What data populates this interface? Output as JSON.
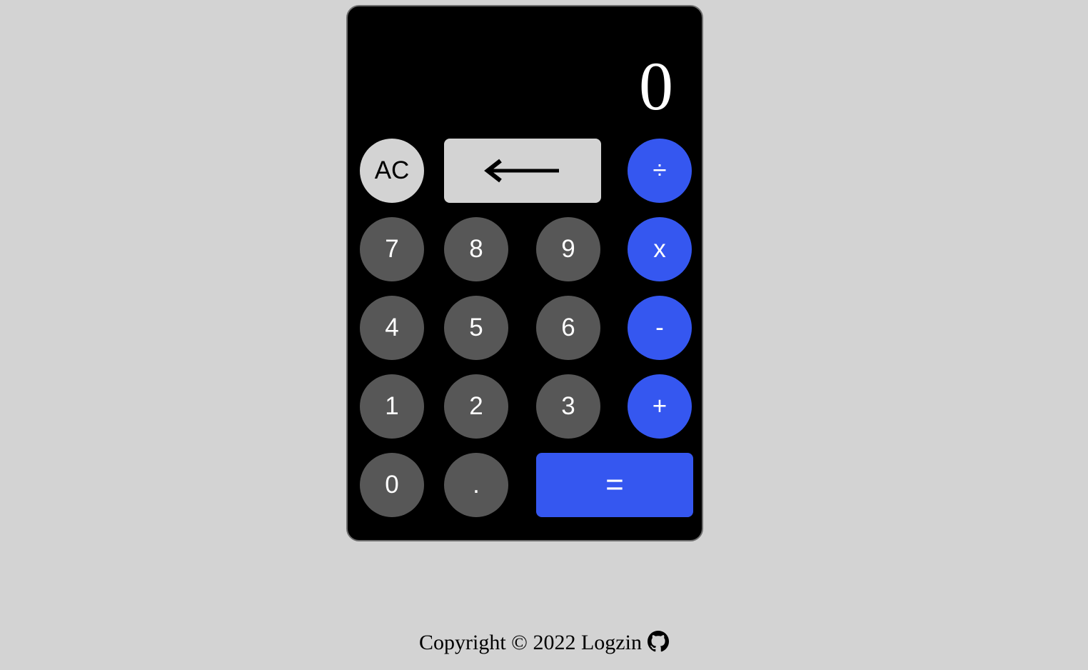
{
  "display": {
    "value": "0"
  },
  "keys": {
    "clear": "AC",
    "backspace_icon": "arrow-left-icon",
    "divide": "÷",
    "multiply": "x",
    "subtract": "-",
    "add": "+",
    "equals": "=",
    "decimal": ".",
    "d7": "7",
    "d8": "8",
    "d9": "9",
    "d4": "4",
    "d5": "5",
    "d6": "6",
    "d1": "1",
    "d2": "2",
    "d3": "3",
    "d0": "0"
  },
  "footer": {
    "text": "Copyright © 2022 Logzin",
    "icon": "github-icon"
  },
  "colors": {
    "page_background": "#d3d3d3",
    "calculator_background": "#000000",
    "number_key": "#575757",
    "operator_key": "#3557f0",
    "function_key": "#d3d3d3"
  }
}
